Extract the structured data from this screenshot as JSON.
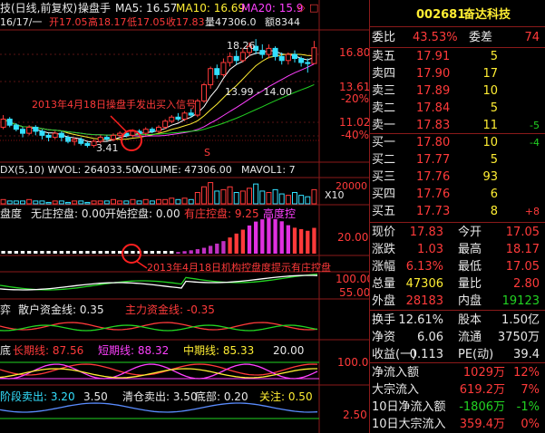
{
  "chart": {
    "top_line": "技(日线,前复权)",
    "indicator_name": "操盘手",
    "ma5": "MA5: 16.57",
    "ma10": "MA10: 16.69",
    "ma20": "MA20: 15.9",
    "date_line": "16/17/一",
    "open": "开17.05",
    "high": "高18.17",
    "low": "低17.05",
    "close": "收17.83",
    "volume_amount": "量47306.0",
    "amount": "额8344",
    "price_hi_label": "18.26",
    "range_label": "13.99 - 14.00",
    "low_label": "3.41",
    "annotation1": "2013年4月18日操盘手发出买入信号",
    "annotation2": "2013年4月18日机构控盘度提示有庄控盘",
    "marker_s": "S",
    "axis_main": [
      "16.80",
      "13.61",
      "-20%",
      "11.02",
      "-40%"
    ],
    "obv_line": "DX(5,10)  WVOL: 264033.50",
    "volume_line": "VOLUME: 47306.00",
    "mavol_line": "MAVOL1: 7",
    "axis_vol": [
      "20000",
      "X10"
    ],
    "control_title": "盘度",
    "control_none": "无庄控盘: 0.00",
    "control_start": "开始控盘: 0.00",
    "control_has": "有庄控盘: 9.25",
    "control_high": "高度控",
    "axis_control": [
      "20.00"
    ],
    "axis_osc": [
      "100.00",
      "55.00"
    ],
    "fund_title": "弈",
    "fund_retail": "散户资金线: 0.35",
    "fund_main": "主力资金线: -0.35",
    "bottom_title": "底",
    "long_line": "长期线: 87.56",
    "short_line": "短期线: 88.32",
    "mid_line": "中期线: 85.33",
    "bottom_val": "20.00",
    "axis_bottom": [
      "100.0"
    ],
    "sell_stage": "阶段卖出: 3.20",
    "sell_stage2": "3.50",
    "sell_clear": "清仓卖出: 3.50",
    "bottom_part": "底部: 0.20",
    "attention": "关注: 0.50",
    "axis_last": [
      "2.50"
    ],
    "candles": [
      {
        "o": 13.9,
        "c": 14.3,
        "h": 14.5,
        "l": 13.8
      },
      {
        "o": 14.3,
        "c": 14.0,
        "h": 14.4,
        "l": 13.9
      },
      {
        "o": 14.0,
        "c": 13.8,
        "h": 14.1,
        "l": 13.7
      },
      {
        "o": 13.8,
        "c": 13.6,
        "h": 13.9,
        "l": 13.4
      },
      {
        "o": 13.6,
        "c": 13.9,
        "h": 14.0,
        "l": 13.5
      },
      {
        "o": 13.9,
        "c": 13.7,
        "h": 14.0,
        "l": 13.5
      },
      {
        "o": 13.7,
        "c": 13.5,
        "h": 13.8,
        "l": 13.3
      },
      {
        "o": 13.5,
        "c": 13.4,
        "h": 13.6,
        "l": 13.2
      },
      {
        "o": 13.4,
        "c": 13.6,
        "h": 13.7,
        "l": 13.3
      },
      {
        "o": 13.6,
        "c": 13.4,
        "h": 13.7,
        "l": 13.2
      },
      {
        "o": 13.4,
        "c": 13.2,
        "h": 13.5,
        "l": 13.1
      },
      {
        "o": 13.2,
        "c": 13.3,
        "h": 13.4,
        "l": 13.0
      },
      {
        "o": 13.3,
        "c": 13.1,
        "h": 13.4,
        "l": 13.0
      },
      {
        "o": 13.1,
        "c": 13.0,
        "h": 13.2,
        "l": 12.9
      },
      {
        "o": 13.0,
        "c": 13.2,
        "h": 13.3,
        "l": 12.9
      },
      {
        "o": 13.2,
        "c": 13.4,
        "h": 13.5,
        "l": 13.1
      },
      {
        "o": 13.4,
        "c": 13.3,
        "h": 13.5,
        "l": 13.2
      },
      {
        "o": 13.3,
        "c": 13.5,
        "h": 13.6,
        "l": 13.2
      },
      {
        "o": 13.5,
        "c": 13.6,
        "h": 13.7,
        "l": 13.4
      },
      {
        "o": 13.6,
        "c": 13.5,
        "h": 13.7,
        "l": 13.4
      },
      {
        "o": 13.5,
        "c": 13.7,
        "h": 13.8,
        "l": 13.4
      },
      {
        "o": 13.7,
        "c": 13.6,
        "h": 13.8,
        "l": 13.5
      },
      {
        "o": 13.6,
        "c": 13.8,
        "h": 13.9,
        "l": 13.5
      },
      {
        "o": 13.8,
        "c": 13.7,
        "h": 13.9,
        "l": 13.6
      },
      {
        "o": 13.7,
        "c": 13.9,
        "h": 14.0,
        "l": 13.6
      },
      {
        "o": 13.9,
        "c": 14.2,
        "h": 14.3,
        "l": 13.8
      },
      {
        "o": 14.2,
        "c": 14.4,
        "h": 14.5,
        "l": 14.1
      },
      {
        "o": 14.4,
        "c": 14.3,
        "h": 14.6,
        "l": 14.2
      },
      {
        "o": 14.3,
        "c": 14.6,
        "h": 14.7,
        "l": 14.2
      },
      {
        "o": 14.6,
        "c": 14.5,
        "h": 14.8,
        "l": 14.4
      },
      {
        "o": 14.5,
        "c": 15.2,
        "h": 15.3,
        "l": 14.4
      },
      {
        "o": 15.2,
        "c": 16.0,
        "h": 16.1,
        "l": 15.1
      },
      {
        "o": 16.0,
        "c": 16.8,
        "h": 16.9,
        "l": 15.8
      },
      {
        "o": 16.8,
        "c": 16.5,
        "h": 17.0,
        "l": 16.3
      },
      {
        "o": 16.5,
        "c": 17.1,
        "h": 17.3,
        "l": 16.4
      },
      {
        "o": 17.1,
        "c": 17.4,
        "h": 17.6,
        "l": 16.9
      },
      {
        "o": 17.4,
        "c": 17.2,
        "h": 17.7,
        "l": 17.0
      },
      {
        "o": 17.2,
        "c": 17.6,
        "h": 17.8,
        "l": 17.1
      },
      {
        "o": 17.6,
        "c": 17.9,
        "h": 18.1,
        "l": 17.4
      },
      {
        "o": 17.9,
        "c": 17.7,
        "h": 18.26,
        "l": 17.5
      },
      {
        "o": 17.7,
        "c": 17.5,
        "h": 18.0,
        "l": 17.3
      },
      {
        "o": 17.5,
        "c": 17.8,
        "h": 18.0,
        "l": 17.3
      },
      {
        "o": 17.8,
        "c": 17.4,
        "h": 17.9,
        "l": 17.2
      },
      {
        "o": 17.4,
        "c": 17.2,
        "h": 17.6,
        "l": 17.0
      },
      {
        "o": 17.2,
        "c": 17.5,
        "h": 17.6,
        "l": 17.0
      },
      {
        "o": 17.5,
        "c": 17.3,
        "h": 17.7,
        "l": 17.1
      },
      {
        "o": 17.3,
        "c": 17.1,
        "h": 17.4,
        "l": 16.9
      },
      {
        "o": 17.1,
        "c": 17.05,
        "h": 17.3,
        "l": 16.6
      },
      {
        "o": 17.05,
        "c": 17.83,
        "h": 18.17,
        "l": 17.05
      }
    ],
    "control_bars": [
      0,
      0,
      0,
      0,
      0,
      0,
      0,
      0,
      0,
      0,
      0,
      0,
      0,
      0,
      0,
      0,
      0,
      0,
      0,
      0,
      0,
      0,
      0,
      0,
      0,
      0,
      0,
      0.6,
      0.9,
      1.2,
      1.6,
      2.1,
      2.8,
      3.6,
      4.5,
      5.8,
      7.2,
      8.6,
      10.1,
      11.5,
      12.3,
      12.9,
      12.4,
      11.6,
      10.2,
      9.3,
      8.8,
      8.2,
      9.25
    ],
    "volume_bars": [
      3,
      2,
      2,
      2,
      3,
      2,
      2,
      1,
      2,
      2,
      1,
      2,
      2,
      1,
      2,
      2,
      2,
      3,
      2,
      2,
      3,
      2,
      3,
      2,
      3,
      3,
      4,
      3,
      4,
      3,
      8,
      12,
      15,
      9,
      10,
      12,
      8,
      9,
      11,
      14,
      9,
      8,
      10,
      7,
      6,
      8,
      6,
      5,
      10
    ]
  },
  "panel": {
    "code": "002681",
    "name": "奋达科技",
    "weibi_label": "委比",
    "weibi_value": "43.53%",
    "weicha_label": "委差",
    "weicha_value": "74",
    "asks": [
      {
        "label": "卖五",
        "price": "17.91",
        "vol": "5",
        "chg": ""
      },
      {
        "label": "卖四",
        "price": "17.90",
        "vol": "17",
        "chg": ""
      },
      {
        "label": "卖三",
        "price": "17.89",
        "vol": "10",
        "chg": ""
      },
      {
        "label": "卖二",
        "price": "17.84",
        "vol": "5",
        "chg": ""
      },
      {
        "label": "卖一",
        "price": "17.83",
        "vol": "11",
        "chg": "-5"
      }
    ],
    "bids": [
      {
        "label": "买一",
        "price": "17.80",
        "vol": "10",
        "chg": "-4"
      },
      {
        "label": "买二",
        "price": "17.77",
        "vol": "5",
        "chg": ""
      },
      {
        "label": "买三",
        "price": "17.76",
        "vol": "93",
        "chg": ""
      },
      {
        "label": "买四",
        "price": "17.76",
        "vol": "6",
        "chg": ""
      },
      {
        "label": "买五",
        "price": "17.73",
        "vol": "8",
        "chg": "+8"
      }
    ],
    "stats": [
      {
        "l1": "现价",
        "v1": "17.83",
        "l2": "今开",
        "v2": "17.05",
        "c1": "red",
        "c2": "red"
      },
      {
        "l1": "涨跌",
        "v1": "1.03",
        "l2": "最高",
        "v2": "18.17",
        "c1": "red",
        "c2": "red"
      },
      {
        "l1": "涨幅",
        "v1": "6.13%",
        "l2": "最低",
        "v2": "17.05",
        "c1": "red",
        "c2": "red"
      },
      {
        "l1": "总量",
        "v1": "47306",
        "l2": "量比",
        "v2": "2.80",
        "c1": "yellow",
        "c2": "red"
      },
      {
        "l1": "外盘",
        "v1": "28183",
        "l2": "内盘",
        "v2": "19123",
        "c1": "red",
        "c2": "green"
      }
    ],
    "stats2": [
      {
        "l1": "换手",
        "v1": "12.61%",
        "l2": "股本",
        "v2": "1.50亿"
      },
      {
        "l1": "净资",
        "v1": "6.06",
        "l2": "流通",
        "v2": "3750万"
      },
      {
        "l1": "收益(一)",
        "v1": "0.113",
        "l2": "PE(动)",
        "v2": "39.4"
      }
    ],
    "flows": [
      {
        "label": "净流入额",
        "value": "1029万",
        "pct": "12%",
        "color": "red"
      },
      {
        "label": "大宗流入",
        "value": "619.2万",
        "pct": "7%",
        "color": "red"
      },
      {
        "label": "10日净流入额",
        "value": "-1806万",
        "pct": "-1%",
        "color": "green"
      },
      {
        "label": "10日大宗流入",
        "value": "359.4万",
        "pct": "0%",
        "color": "red"
      }
    ]
  }
}
